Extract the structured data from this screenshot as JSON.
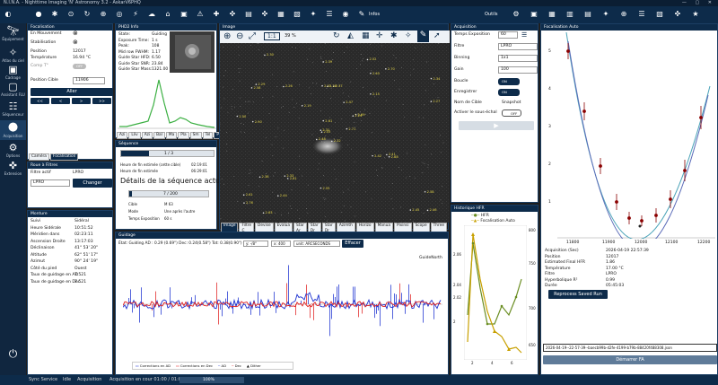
{
  "window_title": "N.I.N.A. - Nighttime Imaging 'N' Astronomy 3.2 - AskarV6PHQ",
  "toolbar": {
    "info_label": "Infos",
    "options_label": "Outils"
  },
  "sidebar": [
    {
      "name": "Équipement",
      "icon": "telescope-icon"
    },
    {
      "name": "Atlas du ciel",
      "icon": "atlas-icon"
    },
    {
      "name": "Cadrage",
      "icon": "framing-icon"
    },
    {
      "name": "Assistant FLU",
      "icon": "flat-icon"
    },
    {
      "name": "Séquenceur",
      "icon": "sequencer-icon"
    },
    {
      "name": "Acquisition",
      "icon": "camera-icon"
    },
    {
      "name": "Options",
      "icon": "gear-icon"
    },
    {
      "name": "Extension",
      "icon": "puzzle-icon"
    }
  ],
  "focuser": {
    "title": "Focalisation",
    "rows": [
      {
        "label": "En Mouvement",
        "value": "⊗"
      },
      {
        "label": "Stabilisation",
        "value": "⊗"
      },
      {
        "label": "Position",
        "value": "12017"
      },
      {
        "label": "Température",
        "value": "16.94 °C"
      },
      {
        "label": "Comp T°",
        "value": "OFF"
      }
    ],
    "target_label": "Position Cible",
    "target_value": "11906",
    "go_button": "Aller",
    "step_buttons": [
      "<<",
      "<",
      ">",
      ">>"
    ],
    "tabs": [
      "Caméra",
      "Focalisation"
    ]
  },
  "filter": {
    "title": "Roue à Filtres",
    "active_label": "Filtre actif",
    "active_value": "LPRO",
    "select_value": "LPRO",
    "change_button": "Changer"
  },
  "mount": {
    "title": "Monture",
    "rows": [
      {
        "label": "Suivi",
        "value": "Sidéral"
      },
      {
        "label": "Heure Sidérale",
        "value": "10:51:52"
      },
      {
        "label": "Méridien dans",
        "value": "02:23:11"
      },
      {
        "label": "Ascension Droite",
        "value": "13:17:03"
      },
      {
        "label": "Déclinaison",
        "value": "41° 53' 20\""
      },
      {
        "label": "Altitude",
        "value": "62° 51' 17\""
      },
      {
        "label": "Azimut",
        "value": "90° 24' 19\""
      },
      {
        "label": "Côté du pied",
        "value": "Ouest"
      },
      {
        "label": "Taux de guidage en AD",
        "value": "7.521"
      },
      {
        "label": "Taux de guidage en Dec",
        "value": "7.521"
      }
    ]
  },
  "phd2": {
    "title": "PHD2 Info",
    "rows": [
      {
        "label": "State:",
        "value": "Guiding"
      },
      {
        "label": "Exposure Time:",
        "value": "1 s"
      },
      {
        "label": "Peak:",
        "value": "108"
      },
      {
        "label": "Mid row FWHM:",
        "value": "1.17"
      },
      {
        "label": "Guide Star HFD:",
        "value": "6.50"
      },
      {
        "label": "Guide Star SNR:",
        "value": "23.84"
      },
      {
        "label": "Guide Star Mass:",
        "value": "1321.00"
      }
    ],
    "tabs": [
      "Azi",
      "Lliv",
      "Azi",
      "Bal",
      "Ma",
      "Pla",
      "Sm",
      "Tel",
      "PHD"
    ]
  },
  "sequence": {
    "title": "Séquence",
    "progress1_label": "1 / 3",
    "end_time_target_label": "Heure de fin estimée (cette cible)",
    "end_time_target_value": "02:19:01",
    "end_time_label": "Heure de fin estimée",
    "end_time_value": "06:29:01",
    "details_title": "Détails de la séquence actu",
    "progress2_label": "7 / 200",
    "rows": [
      {
        "label": "Cible",
        "value": "M 63"
      },
      {
        "label": "Mode",
        "value": "Une après l'autre"
      },
      {
        "label": "Temps Exposition",
        "value": "60 s"
      }
    ]
  },
  "image": {
    "title": "Image",
    "zoom_label": "1:1",
    "zoom_value": "39 %",
    "tabs": [
      "Image",
      "Filtre C",
      "Devise",
      "Évalua",
      "Star Ar",
      "Star Dr",
      "Star Dr",
      "Azimth",
      "Horizo",
      "Manua",
      "Pixinsi",
      "Scope",
      "Three"
    ],
    "stars": [
      "2.32",
      "2.58",
      "2.05",
      "2.61",
      "2.24",
      "2.81",
      "2.52",
      "2.37",
      "2.40",
      "2.71",
      "2.30",
      "2.46",
      "2.90",
      "2.34",
      "2.48",
      "2.15",
      "2.63",
      "2.51",
      "2.47",
      "2.38",
      "2.19",
      "2.76",
      "2.44",
      "2.28",
      "2.69",
      "2.88",
      "2.29",
      "2.39",
      "2.50",
      "2.42",
      "2.27",
      "2.31",
      "2.55",
      "2.61",
      "2.26",
      "2.70",
      "2.33",
      "2.45",
      "2.58",
      "2.41"
    ]
  },
  "acquisition": {
    "title": "Acquisition",
    "exposure_label": "Temps Exposition",
    "exposure_value": "60",
    "filter_label": "Filtre",
    "filter_value": "LPRO",
    "binning_label": "Binning",
    "binning_value": "1x1",
    "gain_label": "Gain",
    "gain_value": "100",
    "loop_label": "Boucle",
    "loop_value": "ON",
    "save_label": "Enregistrer",
    "save_value": "ON",
    "name_label": "Nom de Cible",
    "name_value": "Snapshot",
    "stretch_label": "Activer le sous-échal",
    "stretch_value": "OFF"
  },
  "hfr": {
    "title": "Historique HFR",
    "legend": [
      "HFR",
      "Focalisation Auto"
    ],
    "y_left": [
      "2.06",
      "2.04",
      "2.02",
      "2"
    ],
    "y_right": [
      "800",
      "750",
      "700",
      "650"
    ],
    "x_ticks": [
      "2",
      "4",
      "6"
    ]
  },
  "autofocus": {
    "title": "Focalisation Auto",
    "y_ticks": [
      "5",
      "4",
      "3",
      "2",
      "1"
    ],
    "x_ticks": [
      "11800",
      "11900",
      "12000",
      "12100",
      "12200"
    ],
    "rows": [
      {
        "label": "Acquisition (Sec)",
        "value": "2026-04-19 22:57:39"
      },
      {
        "label": "Position",
        "value": "12017"
      },
      {
        "label": "Estimated Final HFR",
        "value": "1.86"
      },
      {
        "label": "Température",
        "value": "17.00 °C"
      },
      {
        "label": "Filtre",
        "value": "LPRO"
      },
      {
        "label": "Hyperbolique R²",
        "value": "0.99"
      },
      {
        "label": "Durée",
        "value": "05:45:03"
      }
    ],
    "reprocess_button": "Reprocess Saved Run",
    "file_value": "2026-04-19--22-57-39--baecb99b-d2fe-4199-b79b-88420f488308.json",
    "start_button": "Démarrer FA"
  },
  "guiding": {
    "title": "Guidage",
    "status": "État: Guiding AD : 0.29 (0.69\") Dec: 0.24(0.58\") Tot: 0.38(0.90\")",
    "y_select": "y: -/8\"",
    "x_select": "x: 400",
    "unit_select": "unit: ARCSECONDS",
    "clear_button": "Effacer",
    "north_label": "GuideNorth",
    "east_label": "GuideEast",
    "legend": [
      "Corrections en AD",
      "Corrections en Dec",
      "AD",
      "Dec",
      "Dither"
    ],
    "y_ticks": [
      "8",
      "6",
      "4",
      "2",
      "0",
      "-2",
      "-4",
      "-6",
      "-8"
    ]
  },
  "status": {
    "service": "Sync Service",
    "service_value": "Idle",
    "acq_label": "Acquisition",
    "acq_value": "Acquisition en cour 01:00 / 01:00",
    "progress": "100%"
  },
  "colors": {
    "navy": "#0d2b4a",
    "ad": "#1a2fd0",
    "dec": "#e02020"
  }
}
